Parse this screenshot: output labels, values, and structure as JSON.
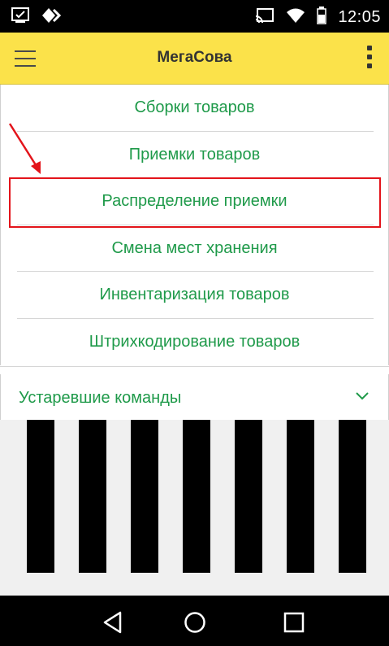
{
  "status_bar": {
    "time": "12:05",
    "icons": [
      "screenshot-icon",
      "vpn-diamond-icon",
      "cast-icon",
      "wifi-icon",
      "battery-icon"
    ]
  },
  "app_bar": {
    "title": "МегаСова",
    "menu_icon": "hamburger-icon",
    "more_icon": "more-vert-icon"
  },
  "menu": {
    "items": [
      {
        "label": "Сборки товаров"
      },
      {
        "label": "Приемки товаров"
      },
      {
        "label": "Распределение приемки"
      },
      {
        "label": "Смена мест хранения"
      },
      {
        "label": "Инвентаризация товаров"
      },
      {
        "label": "Штрихкодирование товаров"
      }
    ]
  },
  "obsolete_section": {
    "label": "Устаревшие команды",
    "icon": "chevron-down-icon"
  },
  "nav_bar": {
    "buttons": [
      "back-icon",
      "home-icon",
      "recents-icon"
    ]
  },
  "colors": {
    "accent_yellow": "#fbe24a",
    "link_green": "#1f9a4a",
    "annotation_red": "#e3141b"
  }
}
